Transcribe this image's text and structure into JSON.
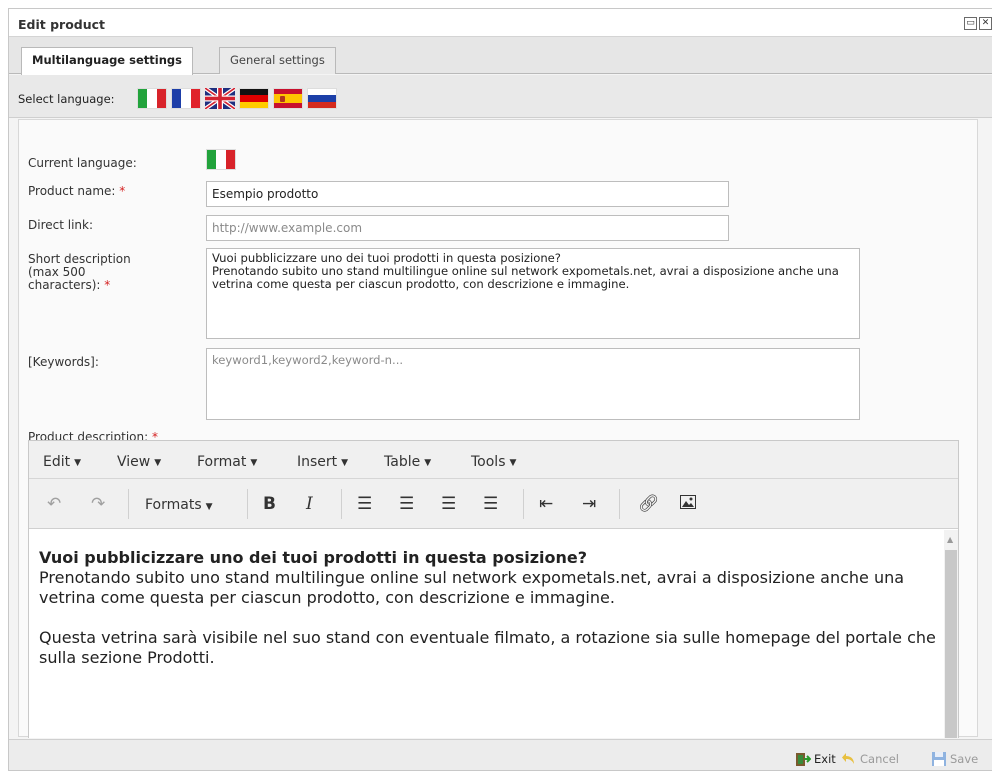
{
  "window": {
    "title": "Edit product",
    "restore_glyph": "▭",
    "close_glyph": "✕"
  },
  "tabs": [
    {
      "label": "Multilanguage settings",
      "active": true
    },
    {
      "label": "General settings",
      "active": false
    }
  ],
  "language_bar": {
    "label": "Select language:",
    "flags": [
      {
        "icon": "italy-flag-icon",
        "colors": [
          "#22a33c",
          "#ffffff",
          "#d8232a"
        ]
      },
      {
        "icon": "france-flag-icon",
        "colors": [
          "#1d3ea8",
          "#ffffff",
          "#e0222b"
        ]
      },
      {
        "icon": "uk-flag-icon",
        "colors": [
          "#1f2f7f",
          "#ffffff",
          "#d32130"
        ]
      },
      {
        "icon": "germany-flag-icon",
        "colors": [
          "#111111",
          "#dd0000",
          "#ffcc00"
        ]
      },
      {
        "icon": "spain-flag-icon",
        "colors": [
          "#c8102e",
          "#ffc400",
          "#c8102e"
        ]
      },
      {
        "icon": "russia-flag-icon",
        "colors": [
          "#ffffff",
          "#1c3fa8",
          "#d52b1e"
        ]
      }
    ]
  },
  "form": {
    "current_language_label": "Current language:",
    "product_name_label": "Product name:",
    "product_name_value": "Esempio prodotto",
    "direct_link_label": "Direct link:",
    "direct_link_placeholder": "http://www.example.com",
    "short_description_label_1": "Short description",
    "short_description_label_2": "(max 500",
    "short_description_label_3": "characters):",
    "short_description_value": "Vuoi pubblicizzare uno dei tuoi prodotti in questa posizione?\nPrenotando subito uno stand multilingue online sul network expometals.net, avrai a disposizione anche una vetrina come questa per ciascun prodotto, con descrizione e immagine.",
    "keywords_label": "[Keywords]:",
    "keywords_placeholder": "keyword1,keyword2,keyword-n...",
    "product_description_label": "Product description:",
    "required_mark": "*"
  },
  "editor": {
    "menus": [
      "Edit",
      "View",
      "Format",
      "Insert",
      "Table",
      "Tools"
    ],
    "menu_caret": "▼",
    "formats_label": "Formats",
    "bold_label": "B",
    "italic_label": "I",
    "content_heading": "Vuoi pubblicizzare uno dei tuoi prodotti in questa posizione?",
    "content_p1": "Prenotando subito uno stand multilingue online sul network expometals.net, avrai a disposizione anche una vetrina come questa per ciascun prodotto, con descrizione e immagine.",
    "content_p2": "Questa vetrina sarà visibile nel suo stand con eventuale filmato, a rotazione sia sulle homepage del portale che sulla sezione Prodotti."
  },
  "footer": {
    "exit_label": "Exit",
    "cancel_label": "Cancel",
    "save_label": "Save"
  }
}
